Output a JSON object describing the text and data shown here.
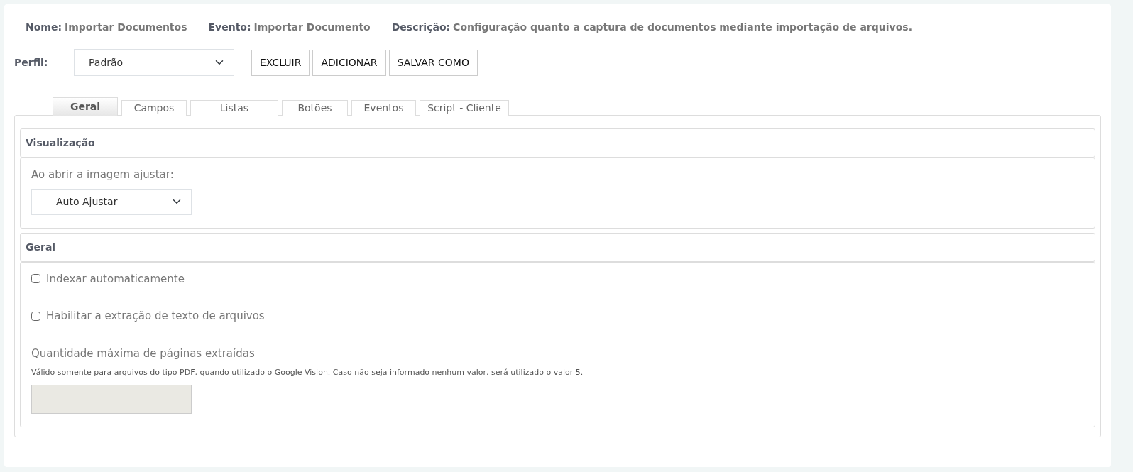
{
  "info": [
    {
      "label": "Nome:",
      "value": "Importar Documentos"
    },
    {
      "label": "Evento:",
      "value": "Importar Documento"
    },
    {
      "label": "Descrição:",
      "value": "Configuração quanto a captura de documentos mediante importação de arquivos."
    }
  ],
  "profile": {
    "label": "Perfil:",
    "value": "Padrão"
  },
  "buttons": [
    "EXCLUIR",
    "ADICIONAR",
    "SALVAR COMO"
  ],
  "tabs": [
    {
      "label": "Geral",
      "selected": true
    },
    {
      "label": "Campos",
      "selected": false
    },
    {
      "label": "Listas",
      "selected": false
    },
    {
      "label": "Botões",
      "selected": false
    },
    {
      "label": "Eventos",
      "selected": false
    },
    {
      "label": "Script - Cliente",
      "selected": false
    }
  ],
  "sections": [
    {
      "title": "Visualização",
      "items": [
        {
          "kind": "select",
          "label": "Ao abrir a imagem ajustar:",
          "value": "Auto Ajustar"
        }
      ]
    },
    {
      "title": "Geral",
      "items": [
        {
          "kind": "checkbox",
          "label": "Indexar automaticamente",
          "checked": false
        },
        {
          "kind": "checkbox",
          "label": "Habilitar a extração de texto de arquivos",
          "checked": false
        },
        {
          "kind": "input",
          "label": "Quantidade máxima de páginas extraídas",
          "help": "Válido somente para arquivos do tipo PDF, quando utilizado o Google Vision. Caso não seja informado nenhum valor, será utilizado o valor 5.",
          "disabled": true
        }
      ]
    }
  ]
}
